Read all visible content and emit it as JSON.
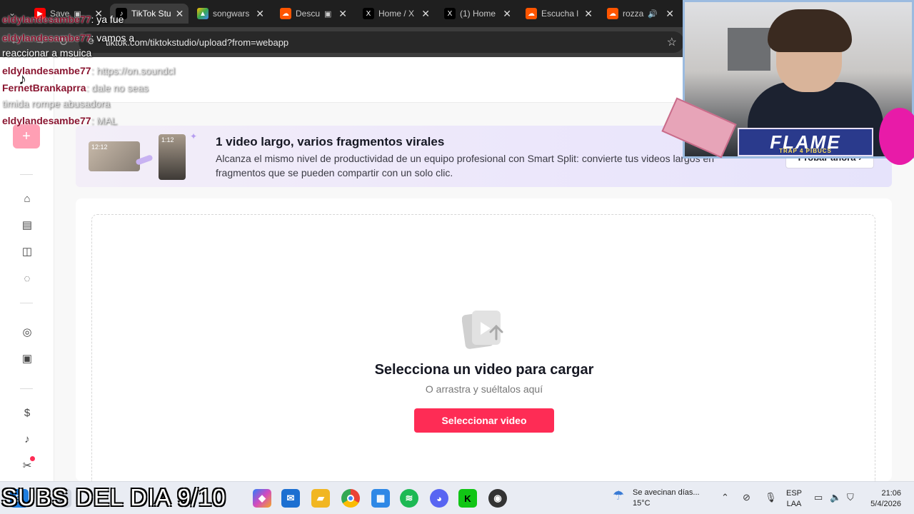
{
  "browser": {
    "tabs": [
      {
        "label": "Save",
        "favicon": "youtube-icon",
        "color": "#ff0000"
      },
      {
        "label": "TikTok Stu",
        "favicon": "tiktok-icon",
        "color": "#000000",
        "active": true
      },
      {
        "label": "songwars",
        "favicon": "drive-icon",
        "color": "#34a853"
      },
      {
        "label": "Descu",
        "favicon": "soundcloud-icon",
        "color": "#ff5500"
      },
      {
        "label": "Home / X",
        "favicon": "x-icon",
        "color": "#000000"
      },
      {
        "label": "(1) Home",
        "favicon": "x-icon",
        "color": "#000000"
      },
      {
        "label": "Escucha l",
        "favicon": "soundcloud-icon",
        "color": "#ff5500"
      },
      {
        "label": "rozza",
        "favicon": "soundcloud-icon",
        "color": "#ff5500"
      }
    ],
    "url": "tiktok.com/tiktokstudio/upload?from=webapp"
  },
  "chat": [
    {
      "user": "eldylandesambe77",
      "msg": ": ya fue"
    },
    {
      "user": "eldylandesambe77",
      "msg": ": vamos a"
    },
    {
      "user": "",
      "msg": "reaccionar a msuica"
    },
    {
      "user": "eldylandesambe77",
      "msg": ": https://on.soundcl"
    },
    {
      "user": "FernetBrankaprra",
      "msg": ": dale no seas"
    },
    {
      "user": "",
      "msg": "timida rompe abusadora"
    },
    {
      "user": "eldylandesambe77",
      "msg": ": MAL"
    }
  ],
  "banner": {
    "title": "1 video largo, varios fragmentos virales",
    "description": "Alcanza el mismo nivel de productividad de un equipo profesional con Smart Split: convierte tus videos largos en fragmentos que se pueden compartir con un solo clic.",
    "button": "Probar ahora",
    "thumb1_time": "12:12",
    "thumb2_time": "1:12"
  },
  "upload": {
    "title": "Selecciona un video para cargar",
    "subtitle": "O arrastra y suéltalos aquí",
    "button": "Seleccionar video"
  },
  "webcam": {
    "badge": "FLAME",
    "badge_sub": "TRAP 4 PIBUCS"
  },
  "taskbar": {
    "weather_line1": "Se avecinan días...",
    "weather_line2": "15°C",
    "lang1": "ESP",
    "lang2": "LAA",
    "time": "21:06",
    "date": "5/4/2026"
  },
  "overlay": {
    "subs": "SUBS DEL DIA 9/10"
  },
  "colors": {
    "brand": "#fe2c55",
    "create_button": "#ff9fb4"
  }
}
